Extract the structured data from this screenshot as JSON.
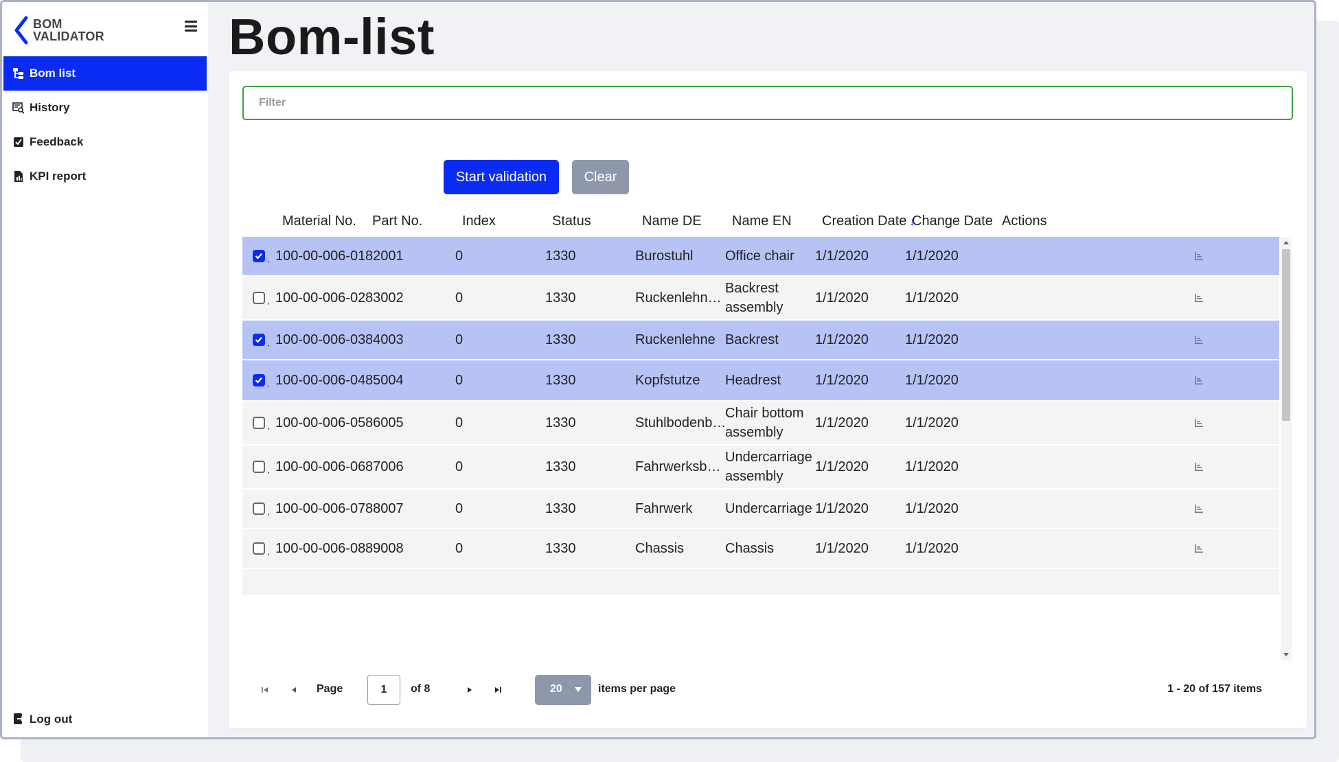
{
  "app": {
    "logo_line1": "BOM",
    "logo_line2": "VALIDATOR",
    "brand_color": "#0a2cf2"
  },
  "sidebar": {
    "items": [
      {
        "label": "Bom list",
        "icon": "hierarchy-icon",
        "active": true
      },
      {
        "label": "History",
        "icon": "history-search-icon",
        "active": false
      },
      {
        "label": "Feedback",
        "icon": "checkbox-icon",
        "active": false
      },
      {
        "label": "KPI report",
        "icon": "report-icon",
        "active": false
      }
    ],
    "logout_label": "Log out"
  },
  "page": {
    "title": "Bom-list"
  },
  "filter": {
    "placeholder": "Filter",
    "value": ""
  },
  "buttons": {
    "start_validation": "Start validation",
    "clear": "Clear"
  },
  "table": {
    "columns": [
      "Material No.",
      "Part No.",
      "Index",
      "Status",
      "Name DE",
      "Name EN",
      "Creation Date",
      "Change Date",
      "Actions"
    ],
    "sort": {
      "column": "Creation Date",
      "direction": "descending"
    },
    "rows": [
      {
        "selected": true,
        "material": "100-00-006-01",
        "part": "82001",
        "index": "0",
        "status": "1330",
        "name_de": "Burostuhl",
        "name_en": "Office chair",
        "created": "1/1/2020",
        "changed": "1/1/2020"
      },
      {
        "selected": false,
        "material": "100-00-006-02",
        "part": "83002",
        "index": "0",
        "status": "1330",
        "name_de": "Ruckenlehn…",
        "name_en": "Backrest assembly",
        "created": "1/1/2020",
        "changed": "1/1/2020"
      },
      {
        "selected": true,
        "material": "100-00-006-03",
        "part": "84003",
        "index": "0",
        "status": "1330",
        "name_de": "Ruckenlehne",
        "name_en": "Backrest",
        "created": "1/1/2020",
        "changed": "1/1/2020"
      },
      {
        "selected": true,
        "material": "100-00-006-04",
        "part": "85004",
        "index": "0",
        "status": "1330",
        "name_de": "Kopfstutze",
        "name_en": "Headrest",
        "created": "1/1/2020",
        "changed": "1/1/2020"
      },
      {
        "selected": false,
        "material": "100-00-006-05",
        "part": "86005",
        "index": "0",
        "status": "1330",
        "name_de": "Stuhlbodenb…",
        "name_en": "Chair bottom assembly",
        "created": "1/1/2020",
        "changed": "1/1/2020"
      },
      {
        "selected": false,
        "material": "100-00-006-06",
        "part": "87006",
        "index": "0",
        "status": "1330",
        "name_de": "Fahrwerksb…",
        "name_en": "Undercarriage assembly",
        "created": "1/1/2020",
        "changed": "1/1/2020"
      },
      {
        "selected": false,
        "material": "100-00-006-07",
        "part": "88007",
        "index": "0",
        "status": "1330",
        "name_de": "Fahrwerk",
        "name_en": "Undercarriage",
        "created": "1/1/2020",
        "changed": "1/1/2020"
      },
      {
        "selected": false,
        "material": "100-00-006-08",
        "part": "89008",
        "index": "0",
        "status": "1330",
        "name_de": "Chassis",
        "name_en": "Chassis",
        "created": "1/1/2020",
        "changed": "1/1/2020"
      }
    ]
  },
  "pager": {
    "page_label": "Page",
    "page": "1",
    "of_label": "of 8",
    "page_size": "20",
    "items_per_page_label": "items per page",
    "summary": "1 - 20 of 157 items"
  }
}
